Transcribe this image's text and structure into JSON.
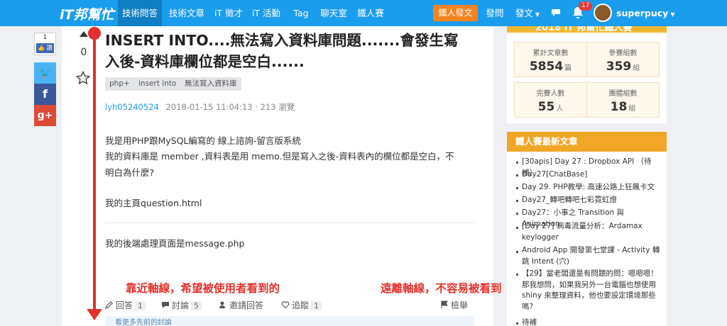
{
  "nav": {
    "logo": "iT邦幫忙",
    "items": [
      "技術問答",
      "技術文章",
      "iT 徵才",
      "iT 活動",
      "Tag",
      "聊天室",
      "鐵人賽"
    ],
    "ironman_post": "鐵人發文",
    "ask": "發問",
    "post": "發文",
    "notification_count": "17",
    "username": "superpucy"
  },
  "share": {
    "count": "1",
    "like": "讚"
  },
  "question": {
    "vote_count": "0",
    "title": "INSERT INTO....無法寫入資料庫問題.......會發生寫入後-資料庫欄位都是空白......",
    "tags": [
      "php+",
      "insert into",
      "無法寫入資料庫"
    ],
    "author": "lyh05240524",
    "datetime": "2018-01-15 11:04:13",
    "views": "213 瀏覽",
    "body": [
      "我是用PHP跟MySQL編寫的 線上諮詢-留言版系統",
      "我的資料庫是 member ,資料表是用 memo.但是寫入之後-資料表內的欄位都是空白，不",
      "明白為什麼?",
      "我的主頁question.html",
      "我的後端處理頁面是message.php"
    ]
  },
  "actions": {
    "answer": "回答",
    "answer_count": "1",
    "discuss": "討論",
    "discuss_count": "5",
    "invite": "邀請回答",
    "follow": "追蹤",
    "follow_count": "1",
    "report": "檢舉",
    "more_comments": "看更多先前的討論"
  },
  "annotations": {
    "near": "靠近軸線，希望被使用者看到的",
    "far": "遠離軸線，不容易被看到"
  },
  "stats": {
    "banner": "2018 iT 邦幫忙鐵人賽",
    "items": [
      {
        "label": "累計文章數",
        "value": "5854",
        "unit": "篇"
      },
      {
        "label": "參賽組數",
        "value": "359",
        "unit": "組"
      },
      {
        "label": "完賽人數",
        "value": "55",
        "unit": "人"
      },
      {
        "label": "團體組數",
        "value": "18",
        "unit": "組"
      }
    ]
  },
  "latest": {
    "heading": "鐵人賽最新文章",
    "items": [
      "[30apis] Day 27 : Dropbox API （待補）",
      "Day27[ChatBase]",
      "Day 29. PHP教學: 高速公路上狂飆卡文",
      "Day27_轉吧轉吧七彩霓虹燈",
      "Day27：小事之 Transition 與 Animation",
      "[Day 27] 病毒流量分析：Ardamax keylogger",
      "Android App 開發第七堂課 - Activity 轉跳 Intent (穴)",
      "【29】當老闆還是有問題的問：嗯嗯嗯！那我想問，如果我另外一台電腦也想使用shiny 來整理資料，他也要設定環境那些嗎?",
      "待補"
    ]
  }
}
